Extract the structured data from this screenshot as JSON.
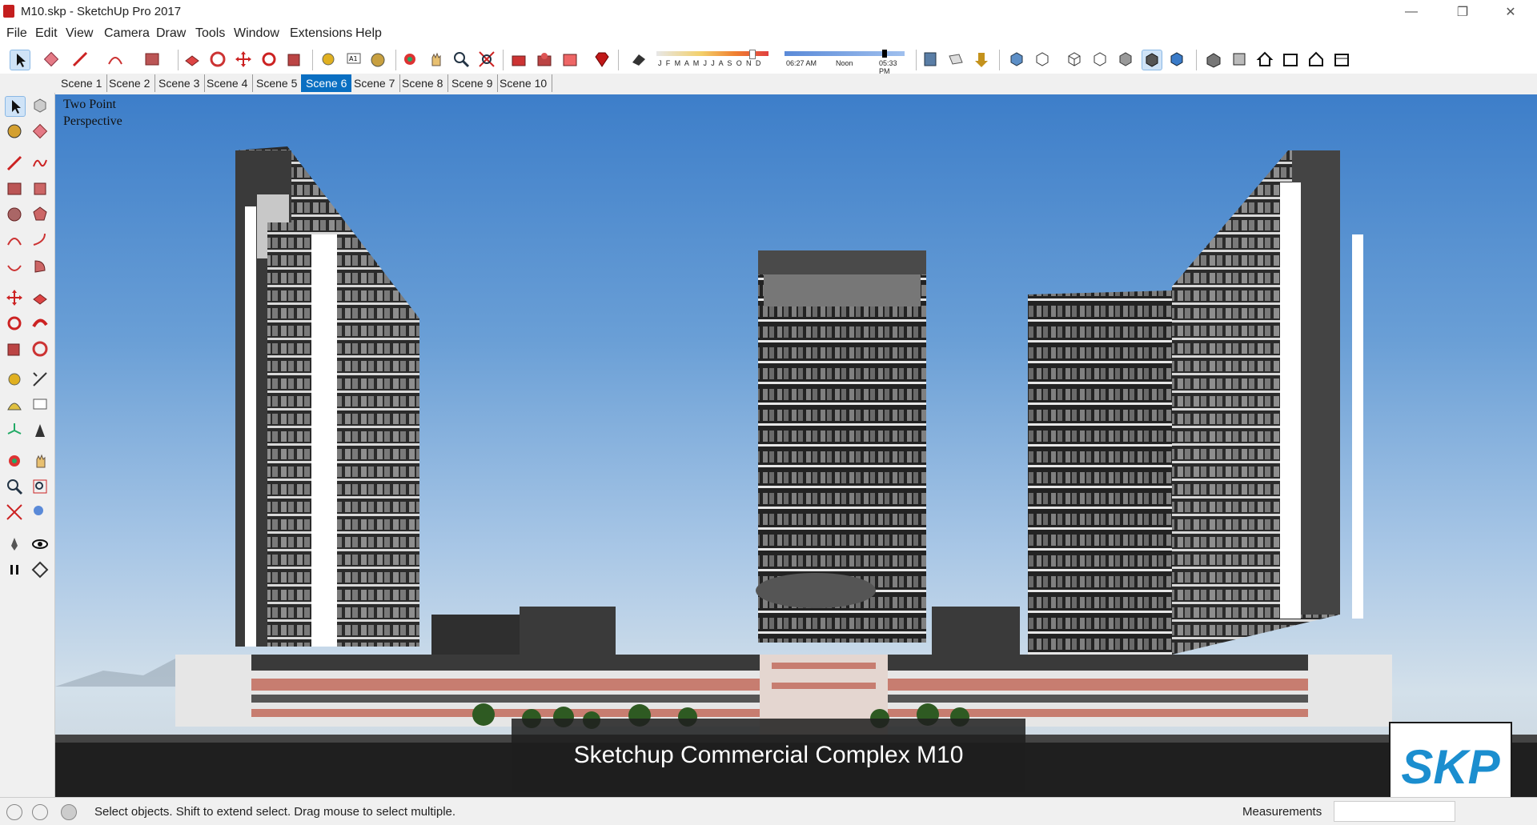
{
  "window": {
    "title": "M10.skp - SketchUp Pro 2017"
  },
  "menu": [
    "File",
    "Edit",
    "View",
    "Camera",
    "Draw",
    "Tools",
    "Window",
    "Extensions",
    "Help"
  ],
  "shadow": {
    "months": "J F M A M J J A S O N D",
    "time_start": "06:27 AM",
    "time_noon": "Noon",
    "time_end": "05:33 PM"
  },
  "scenes": [
    "Scene 1",
    "Scene 2",
    "Scene 3",
    "Scene 4",
    "Scene 5",
    "Scene 6",
    "Scene 7",
    "Scene 8",
    "Scene 9",
    "Scene 10"
  ],
  "active_scene": "Scene 6",
  "viewport": {
    "projection_line1": "Two Point",
    "projection_line2": "Perspective",
    "caption": "Sketchup Commercial Complex M10"
  },
  "logo": "SKP",
  "status": {
    "message": "Select objects. Shift to extend select. Drag mouse to select multiple.",
    "measurements_label": "Measurements",
    "measurements_value": ""
  },
  "colors": {
    "active_scene": "#0a6fc2",
    "logo_text": "#1b8ecf"
  }
}
